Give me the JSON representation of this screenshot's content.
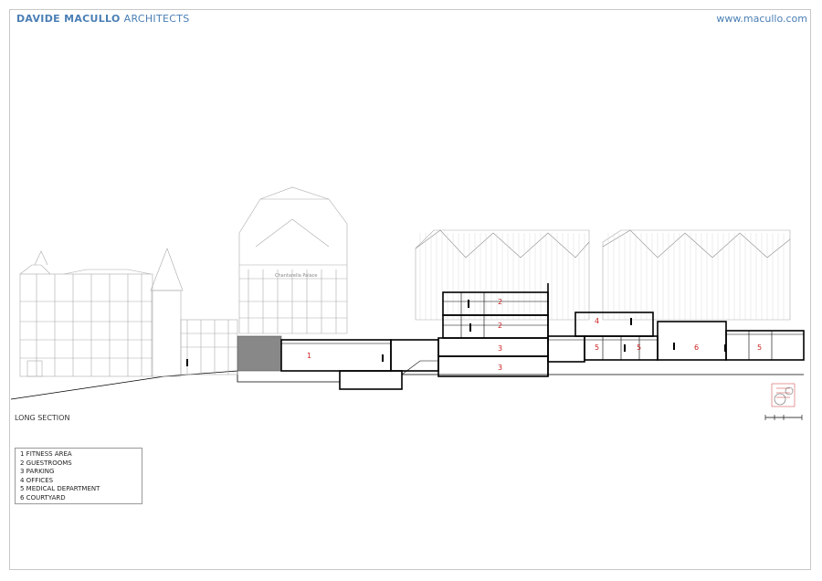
{
  "header": {
    "brand_strong": "DAVIDE MACULLO",
    "brand_light": "ARCHITECTS",
    "url": "www.macullo.com"
  },
  "drawing": {
    "section_label": "LONG SECTION",
    "facade_sign": "Chantarella Palace",
    "legend": [
      "1 FITNESS AREA",
      "2 GUESTROOMS",
      "3 PARKING",
      "4 OFFICES",
      "5 MEDICAL DEPARTMENT",
      "6 COURTYARD"
    ],
    "rooms": [
      "1",
      "2",
      "2",
      "3",
      "3",
      "4",
      "5",
      "5",
      "6",
      "5"
    ],
    "colors": {
      "brand": "#4a7fb5",
      "room_numbers": "#cc2222",
      "lines": "#000000"
    }
  }
}
